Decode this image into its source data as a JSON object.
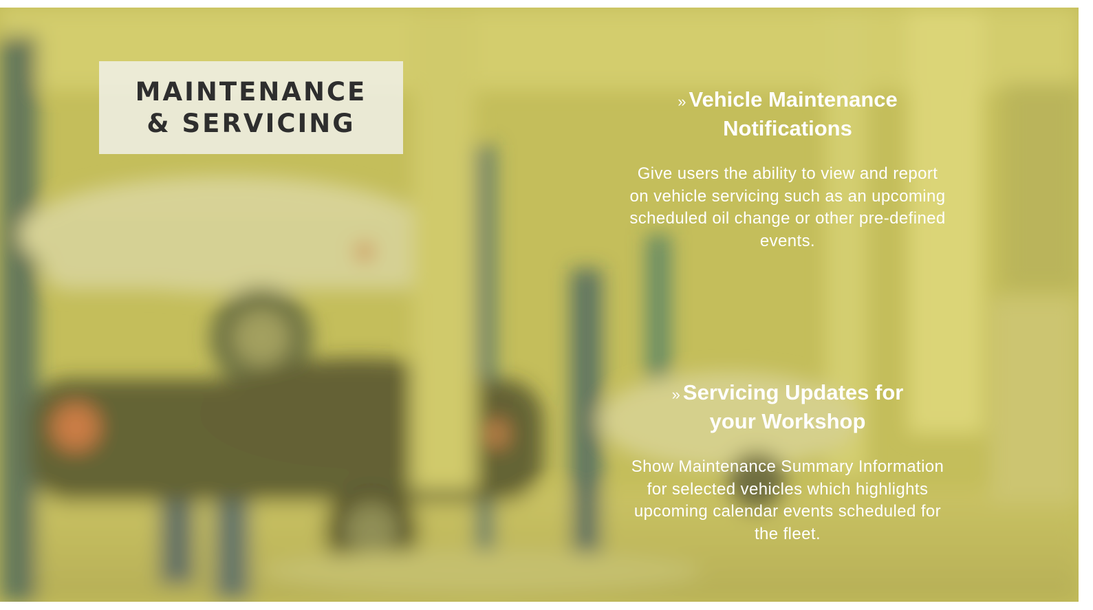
{
  "slide": {
    "title_line1": "MAINTENANCE",
    "title_line2": "& SERVICING"
  },
  "features": [
    {
      "bullet": "»",
      "title_line1": "Vehicle Maintenance",
      "title_line2": "Notifications",
      "description": "Give users the ability to view and report on vehicle servicing such as an upcoming scheduled oil change or other pre-defined events."
    },
    {
      "bullet": "»",
      "title_line1": "Servicing Updates for",
      "title_line2": "your Workshop",
      "description": "Show Maintenance Summary Information for selected vehicles which highlights upcoming calendar events scheduled for the fleet."
    }
  ],
  "colors": {
    "overlay": "#c9c25a",
    "title_text": "#2e2e2e",
    "feature_text": "#ffffff"
  }
}
